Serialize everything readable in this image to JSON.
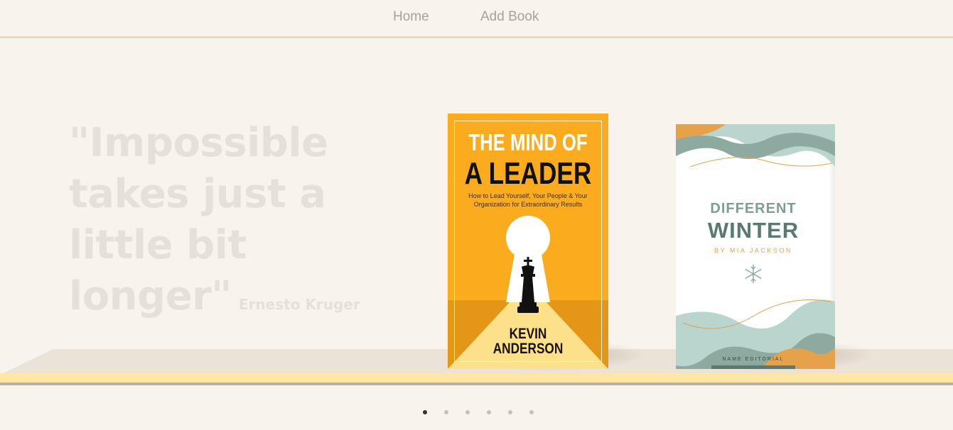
{
  "nav": {
    "home_label": "Home",
    "add_book_label": "Add Book"
  },
  "hero": {
    "quote": "\"Impossible takes just a little bit longer\"",
    "author": "Ernesto Kruger"
  },
  "books": [
    {
      "title_line1": "THE MIND OF",
      "title_line2": "A LEADER",
      "subtitle": "How to Lead Yourself, Your People & Your Organization for Extraordinary Results",
      "author_line1": "KEVIN",
      "author_line2": "ANDERSON",
      "cover_color": "#fbac1e"
    },
    {
      "title_line1": "DIFFERENT",
      "title_line2": "WINTER",
      "byline": "BY MIA JACKSON",
      "publisher": "NAME EDITORIAL",
      "cover_color": "#ffffff",
      "accent_color": "#587a71"
    }
  ],
  "carousel": {
    "total_slides": 6,
    "active_index": 0
  },
  "colors": {
    "background": "#f8f3ed",
    "nav_border": "#ecd9bd",
    "shelf_edge": "#ffe6a6"
  }
}
